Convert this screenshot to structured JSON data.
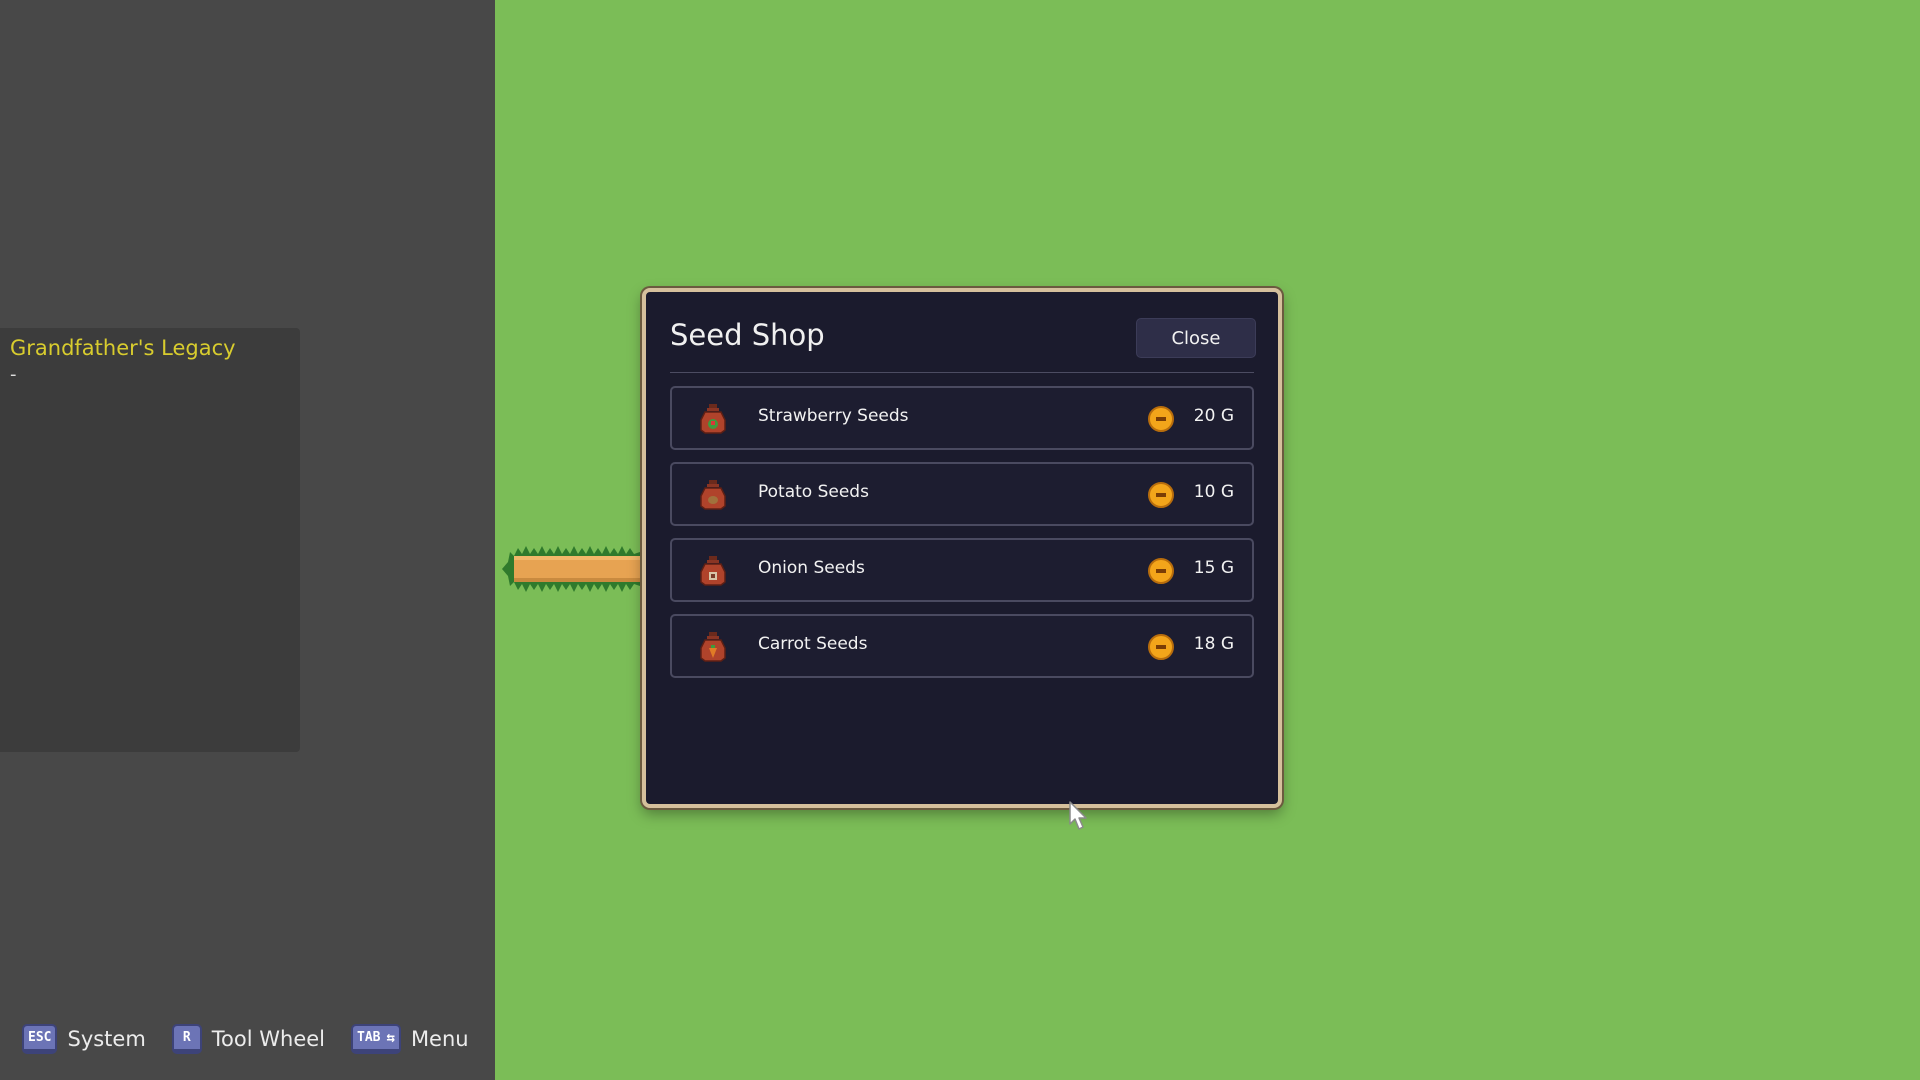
{
  "quest": {
    "title": "Grandfather's Legacy",
    "detail": "-"
  },
  "hotkeys": [
    {
      "key": "ESC",
      "label": "System"
    },
    {
      "key": "R",
      "label": "Tool Wheel"
    },
    {
      "key": "TAB",
      "label": "Menu"
    }
  ],
  "shop": {
    "title": "Seed Shop",
    "close_label": "Close",
    "items": [
      {
        "name": "Strawberry Seeds",
        "price": "20 G",
        "icon": "strawberry-seed-bag-icon",
        "accent": "#3f9b3c"
      },
      {
        "name": "Potato Seeds",
        "price": "10 G",
        "icon": "potato-seed-bag-icon",
        "accent": "#a1713c"
      },
      {
        "name": "Onion Seeds",
        "price": "15 G",
        "icon": "onion-seed-bag-icon",
        "accent": "#d8c6a8"
      },
      {
        "name": "Carrot Seeds",
        "price": "18 G",
        "icon": "carrot-seed-bag-icon",
        "accent": "#e07b26"
      }
    ]
  },
  "colors": {
    "grass": "#7bbd57",
    "panel": "#484848",
    "dialog_bg": "#1b1b2d",
    "dialog_border": "#d5c09c",
    "quest_title": "#d8cc2e",
    "coin": "#f3a51a"
  }
}
